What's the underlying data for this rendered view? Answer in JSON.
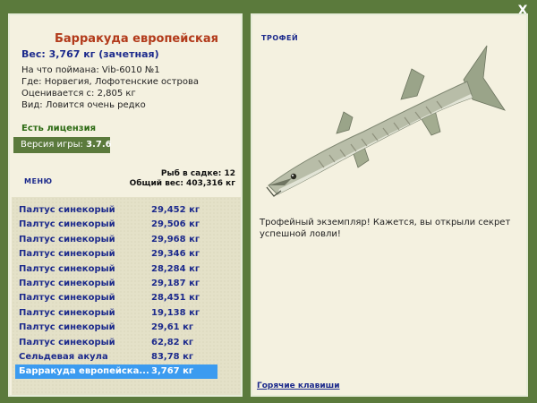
{
  "close_label": "X",
  "fish": {
    "title": "Барракуда европейская",
    "weight": "Вес: 3,767 кг (зачетная)",
    "info": [
      "На что поймана: Vib-6010 №1",
      "Где: Норвегия, Лофотенские острова",
      "Оценивается с: 2,805 кг",
      "Вид: Ловится очень редко"
    ]
  },
  "license": "Есть лицензия",
  "version": {
    "label": "Версия игры: ",
    "value": "3.7.6"
  },
  "menu_label": "МЕНЮ",
  "stats": {
    "count": "Рыб в садке: 12",
    "total": "Общий вес: 403,316 кг"
  },
  "catch_list": [
    {
      "name": "Палтус синекорый",
      "weight": "29,452 кг"
    },
    {
      "name": "Палтус синекорый",
      "weight": "29,506 кг"
    },
    {
      "name": "Палтус синекорый",
      "weight": "29,968 кг"
    },
    {
      "name": "Палтус синекорый",
      "weight": "29,346 кг"
    },
    {
      "name": "Палтус синекорый",
      "weight": "28,284 кг"
    },
    {
      "name": "Палтус синекорый",
      "weight": "29,187 кг"
    },
    {
      "name": "Палтус синекорый",
      "weight": "28,451 кг"
    },
    {
      "name": "Палтус синекорый",
      "weight": "19,138 кг"
    },
    {
      "name": "Палтус синекорый",
      "weight": "29,61 кг"
    },
    {
      "name": "Палтус синекорый",
      "weight": "62,82 кг"
    },
    {
      "name": "Сельдевая акула",
      "weight": "83,78 кг"
    },
    {
      "name": "Барракуда европейска...",
      "weight": "3,767 кг"
    }
  ],
  "selected_index": 11,
  "trophy": {
    "label": "ТРОФЕЙ",
    "text": "Трофейный экземпляр! Кажется, вы открыли секрет успешной ловли!"
  },
  "hotkeys": "Горячие клавиши",
  "colors": {
    "background": "#5b7a3c",
    "panel": "#f4f1e0",
    "title": "#b23a1a",
    "link": "#1c2a8c",
    "selected": "#3b9bf0"
  }
}
